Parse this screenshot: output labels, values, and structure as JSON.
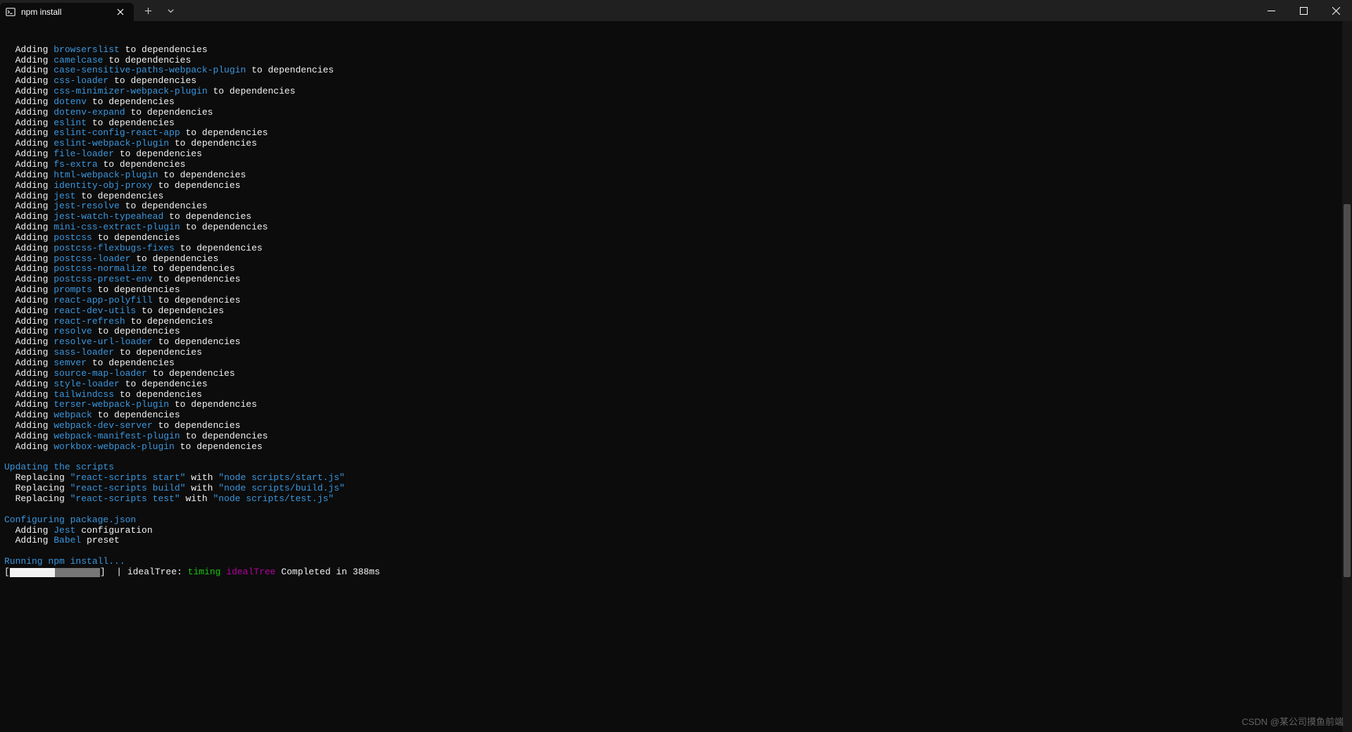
{
  "tab": {
    "title": "npm install"
  },
  "adding_prefix": "Adding ",
  "adding_suffix": " to dependencies",
  "packages": [
    "browserslist",
    "camelcase",
    "case-sensitive-paths-webpack-plugin",
    "css-loader",
    "css-minimizer-webpack-plugin",
    "dotenv",
    "dotenv-expand",
    "eslint",
    "eslint-config-react-app",
    "eslint-webpack-plugin",
    "file-loader",
    "fs-extra",
    "html-webpack-plugin",
    "identity-obj-proxy",
    "jest",
    "jest-resolve",
    "jest-watch-typeahead",
    "mini-css-extract-plugin",
    "postcss",
    "postcss-flexbugs-fixes",
    "postcss-loader",
    "postcss-normalize",
    "postcss-preset-env",
    "prompts",
    "react-app-polyfill",
    "react-dev-utils",
    "react-refresh",
    "resolve",
    "resolve-url-loader",
    "sass-loader",
    "semver",
    "source-map-loader",
    "style-loader",
    "tailwindcss",
    "terser-webpack-plugin",
    "webpack",
    "webpack-dev-server",
    "webpack-manifest-plugin",
    "workbox-webpack-plugin"
  ],
  "updating": {
    "header": "Updating the scripts",
    "prefix": "  Replacing ",
    "with": " with ",
    "items": [
      {
        "from": "\"react-scripts start\"",
        "to": "\"node scripts/start.js\""
      },
      {
        "from": "\"react-scripts build\"",
        "to": "\"node scripts/build.js\""
      },
      {
        "from": "\"react-scripts test\"",
        "to": "\"node scripts/test.js\""
      }
    ]
  },
  "configuring": {
    "header": "Configuring package.json",
    "jest_prefix": "  Adding ",
    "jest_pkg": "Jest",
    "jest_suffix": " configuration",
    "babel_prefix": "  Adding ",
    "babel_pkg": "Babel",
    "babel_suffix": " preset"
  },
  "running": {
    "header": "Running npm install...",
    "progress_open": "[",
    "progress_close": "]  | idealTree: ",
    "timing": "timing",
    "space": " ",
    "idealTree": "idealTree",
    "completed": " Completed in 388ms"
  },
  "watermark": "CSDN @某公司摸鱼前端"
}
